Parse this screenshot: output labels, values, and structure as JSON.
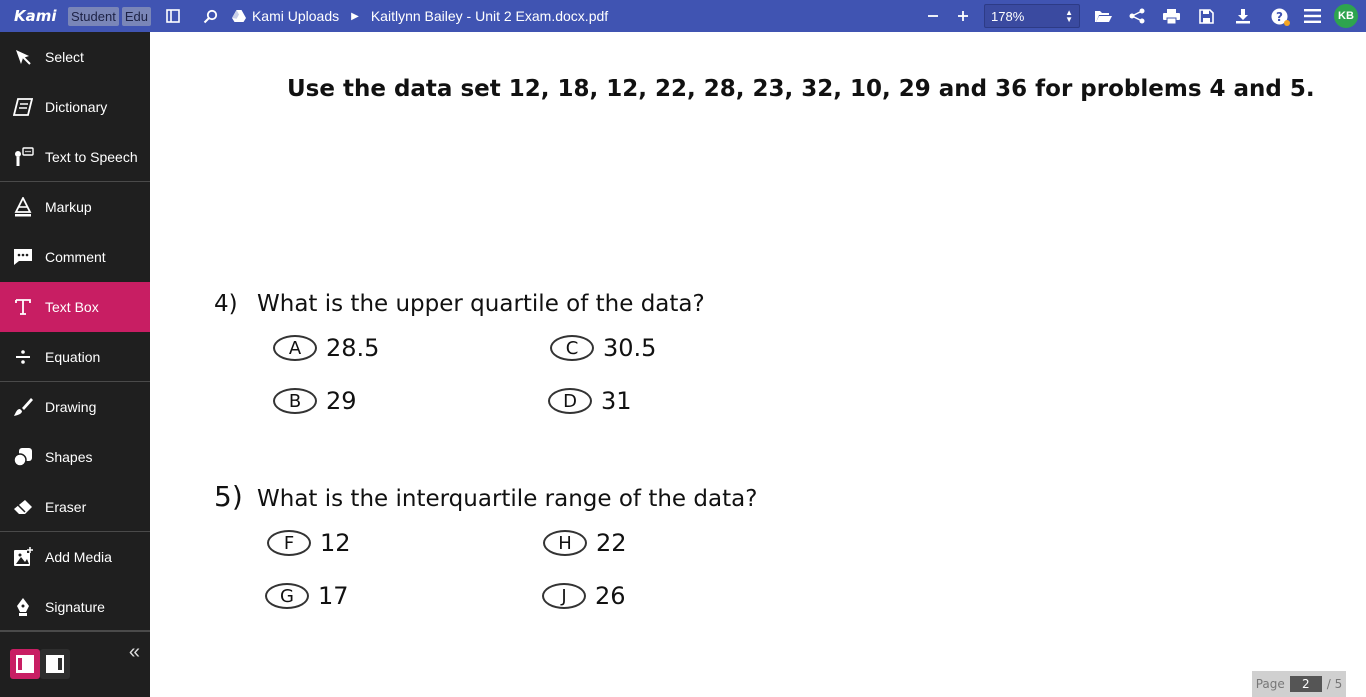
{
  "topbar": {
    "logo": "Kami",
    "badges": [
      "Student",
      "Edu"
    ],
    "breadcrumb": [
      "Kami Uploads",
      "Kaitlynn Bailey - Unit 2 Exam.docx.pdf"
    ],
    "zoom": "178%",
    "avatar": "KB",
    "colors": {
      "bar": "#4054b2",
      "avatar": "#2ea44f",
      "notify": "#f5a623"
    }
  },
  "sidebar": {
    "items": [
      {
        "label": "Select",
        "icon": "cursor-arrow-icon"
      },
      {
        "label": "Dictionary",
        "icon": "book-icon"
      },
      {
        "label": "Text to Speech",
        "icon": "speech-icon"
      },
      {
        "label": "Markup",
        "icon": "markup-pen-icon"
      },
      {
        "label": "Comment",
        "icon": "comment-icon"
      },
      {
        "label": "Text Box",
        "icon": "text-box-icon"
      },
      {
        "label": "Equation",
        "icon": "divide-icon"
      },
      {
        "label": "Drawing",
        "icon": "brush-icon"
      },
      {
        "label": "Shapes",
        "icon": "shapes-icon"
      },
      {
        "label": "Eraser",
        "icon": "eraser-icon"
      },
      {
        "label": "Add Media",
        "icon": "media-icon"
      },
      {
        "label": "Signature",
        "icon": "fountain-pen-icon"
      }
    ],
    "active": "Text Box",
    "active_color": "#c81e63"
  },
  "document": {
    "heading": "Use the data set 12, 18, 12, 22, 28, 23, 32, 10, 29 and 36 for problems 4 and 5.",
    "q4": {
      "num": "4)",
      "text": "What is the upper quartile of the data?",
      "options": [
        {
          "letter": "A",
          "value": "28.5"
        },
        {
          "letter": "C",
          "value": "30.5"
        },
        {
          "letter": "B",
          "value": "29"
        },
        {
          "letter": "D",
          "value": "31"
        }
      ]
    },
    "q5": {
      "num": "5)",
      "text": "What is the interquartile range of the data?",
      "options": [
        {
          "letter": "F",
          "value": "12"
        },
        {
          "letter": "H",
          "value": "22"
        },
        {
          "letter": "G",
          "value": "17"
        },
        {
          "letter": "J",
          "value": "26"
        }
      ]
    }
  },
  "pager": {
    "label": "Page",
    "current": "2",
    "total": "/ 5"
  }
}
